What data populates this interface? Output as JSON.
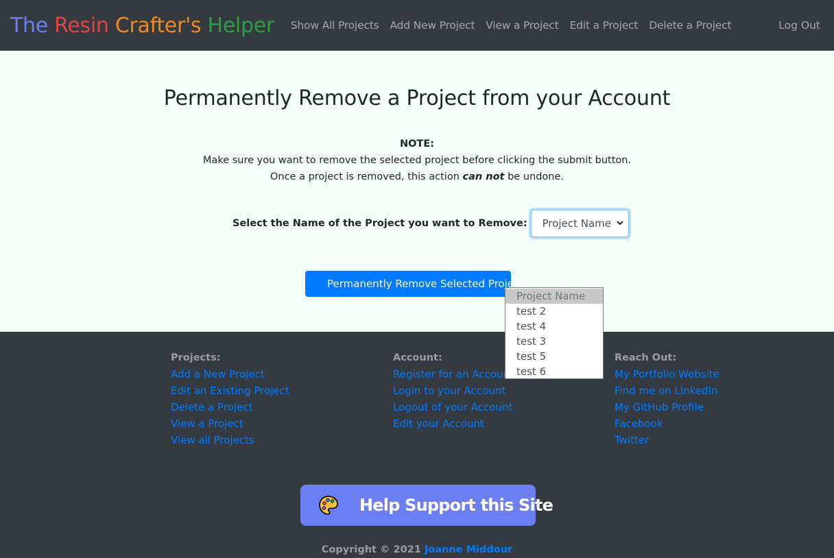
{
  "navbar": {
    "brand": {
      "word1": "The",
      "word1_color": "#6c7ff2",
      "word2": "Resin",
      "word2_color": "#e04545",
      "word3": "Crafter's",
      "word3_color": "#f08a1e",
      "word4": "Helper",
      "word4_color": "#2e9e44"
    },
    "links": [
      "Show All Projects",
      "Add New Project",
      "View a Project",
      "Edit a Project",
      "Delete a Project"
    ],
    "logout": "Log Out"
  },
  "main": {
    "title": "Permanently Remove a Project from your Account",
    "note_heading": "NOTE:",
    "note_line1": "Make sure you want to remove the selected project before clicking the submit button.",
    "note_line2_prefix": "Once a project is removed, this action ",
    "note_line2_emphasis": "can not",
    "note_line2_suffix": " be undone.",
    "select_label": "Select the Name of the Project you want to Remove:",
    "select_value": "Project Name",
    "options": [
      "Project Name",
      "test 2",
      "test 4",
      "test 3",
      "test 5",
      "test 6"
    ],
    "submit_label": "Permanently Remove Selected Project"
  },
  "footer": {
    "columns": [
      {
        "heading": "Projects:",
        "links": [
          "Add a New Project",
          "Edit an Existing Project",
          "Delete a Project",
          "View a Project",
          "View all Projects"
        ]
      },
      {
        "heading": "Account:",
        "links": [
          "Register for an Account",
          "Login to your Account",
          "Logout of your Account",
          "Edit your Account"
        ]
      },
      {
        "heading": "Reach Out:",
        "links": [
          "My Portfolio Website",
          "Find me on LinkedIn",
          "My GitHub Profile",
          "Facebook",
          "Twitter"
        ]
      }
    ],
    "support_label": "Help Support this Site",
    "copyright_prefix": "Copyright © 2021 ",
    "copyright_name": "Joanne Middour"
  },
  "colors": {
    "nav_bg": "#343a40",
    "main_bg": "#f4fffa",
    "accent": "#007bff",
    "support_bg": "#6c7ff2"
  },
  "icons": {
    "support": "palette-icon",
    "select": "chevron-down-icon"
  }
}
